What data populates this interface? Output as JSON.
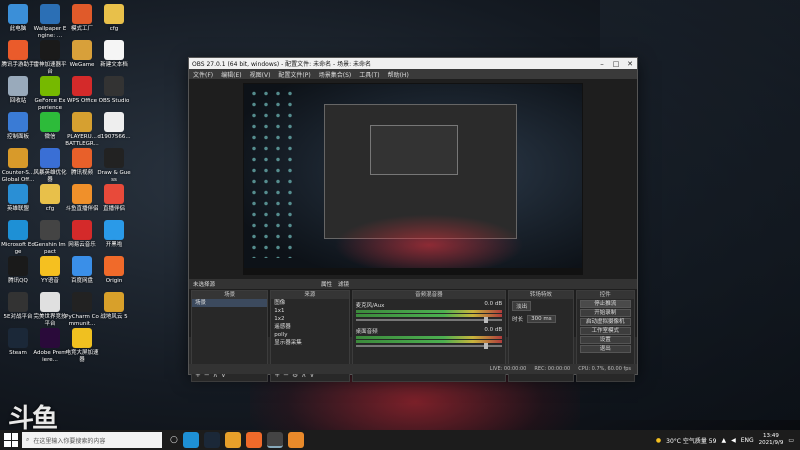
{
  "desktop": {
    "icons": [
      {
        "label": "此电脑",
        "color": "#3b8fd8"
      },
      {
        "label": "Wallpaper Engine: ...",
        "color": "#2b6fb5"
      },
      {
        "label": "模式工厂",
        "color": "#e05a2a"
      },
      {
        "label": "cfg",
        "color": "#e8c04a"
      },
      {
        "label": "腾讯手游助手",
        "color": "#ea5b2b"
      },
      {
        "label": "雷神加速器平台",
        "color": "#1a1a1a"
      },
      {
        "label": "WeGame",
        "color": "#d8a03a"
      },
      {
        "label": "新建文本档",
        "color": "#f5f5f5"
      },
      {
        "label": "回收站",
        "color": "#9ab"
      },
      {
        "label": "GeForce Experience",
        "color": "#76b900"
      },
      {
        "label": "WPS Office",
        "color": "#d42a2a"
      },
      {
        "label": "OBS Studio",
        "color": "#333"
      },
      {
        "label": "控制面板",
        "color": "#3a7bd5"
      },
      {
        "label": "微信",
        "color": "#2dbb3a"
      },
      {
        "label": "PLAYERU... BATTLEGR...",
        "color": "#d6a030"
      },
      {
        "label": "d1907566...",
        "color": "#eee"
      },
      {
        "label": "Counter-S... Global Off...",
        "color": "#d89a2a"
      },
      {
        "label": "风暴英雄优化器",
        "color": "#3a6fd5"
      },
      {
        "label": "腾讯视频",
        "color": "#e8602a"
      },
      {
        "label": "Draw & Guess",
        "color": "#222"
      },
      {
        "label": "英雄联盟",
        "color": "#2a8fd5"
      },
      {
        "label": "cfg",
        "color": "#e8c04a"
      },
      {
        "label": "斗鱼直播伴侣",
        "color": "#f0902a"
      },
      {
        "label": "直播伴侣",
        "color": "#e84a3a"
      },
      {
        "label": "Microsoft Edge",
        "color": "#1e90d5"
      },
      {
        "label": "Genshin Impact",
        "color": "#444"
      },
      {
        "label": "网易云音乐",
        "color": "#d42a2a"
      },
      {
        "label": "开黑啦",
        "color": "#2a9ae8"
      },
      {
        "label": "腾讯QQ",
        "color": "#1a1a1a"
      },
      {
        "label": "YY语音",
        "color": "#f5c020"
      },
      {
        "label": "百度网盘",
        "color": "#3a8fe8"
      },
      {
        "label": "Origin",
        "color": "#f06a2a"
      },
      {
        "label": "5E对战平台",
        "color": "#333"
      },
      {
        "label": "完美世界竞技平台",
        "color": "#e0e0e0"
      },
      {
        "label": "PyCharm Communit...",
        "color": "#222"
      },
      {
        "label": "战地风云 5",
        "color": "#d8a02a"
      },
      {
        "label": "Steam",
        "color": "#1b2838"
      },
      {
        "label": "Adobe Premiere...",
        "color": "#2a0a3a"
      },
      {
        "label": "电竞大屏加速器",
        "color": "#f0c020"
      }
    ]
  },
  "obs": {
    "title": "OBS 27.0.1 (64 bit, windows) - 配置文件: 未命名 - 场景: 未命名",
    "menu": [
      "文件(F)",
      "编辑(E)",
      "视图(V)",
      "配置文件(P)",
      "场景集合(S)",
      "工具(T)",
      "帮助(H)"
    ],
    "scene_bar": [
      "未选择源",
      "属性",
      "滤镜"
    ],
    "docks": {
      "scenes": {
        "title": "场景",
        "items": [
          "场景"
        ]
      },
      "sources": {
        "title": "来源",
        "items": [
          "图像",
          "1x1",
          "1x2",
          "遥感器",
          "polly",
          "显示器采集"
        ]
      },
      "mixer": {
        "title": "音频混音器",
        "channels": [
          {
            "name": "麦克风/Aux",
            "db": "0.0 dB"
          },
          {
            "name": "桌面音频",
            "db": "0.0 dB"
          }
        ]
      },
      "transitions": {
        "title": "转场特效",
        "type": "淡出",
        "duration_label": "时长",
        "duration_value": "300 ms"
      },
      "controls": {
        "title": "控件",
        "buttons": [
          "停止推流",
          "开始录制",
          "启动虚拟摄像机",
          "工作室模式",
          "设置",
          "退出"
        ]
      }
    },
    "status": {
      "live": "LIVE: 00:00:00",
      "rec": "REC: 00:00:00",
      "cpu": "CPU: 0.7%, 60.00 fps"
    }
  },
  "taskbar": {
    "search_placeholder": "在这里输入你要搜索的内容",
    "weather": "30°C 空气质量 59",
    "lang": "ENG",
    "time": "13:49",
    "date": "2021/9/9"
  },
  "watermark": "斗鱼"
}
